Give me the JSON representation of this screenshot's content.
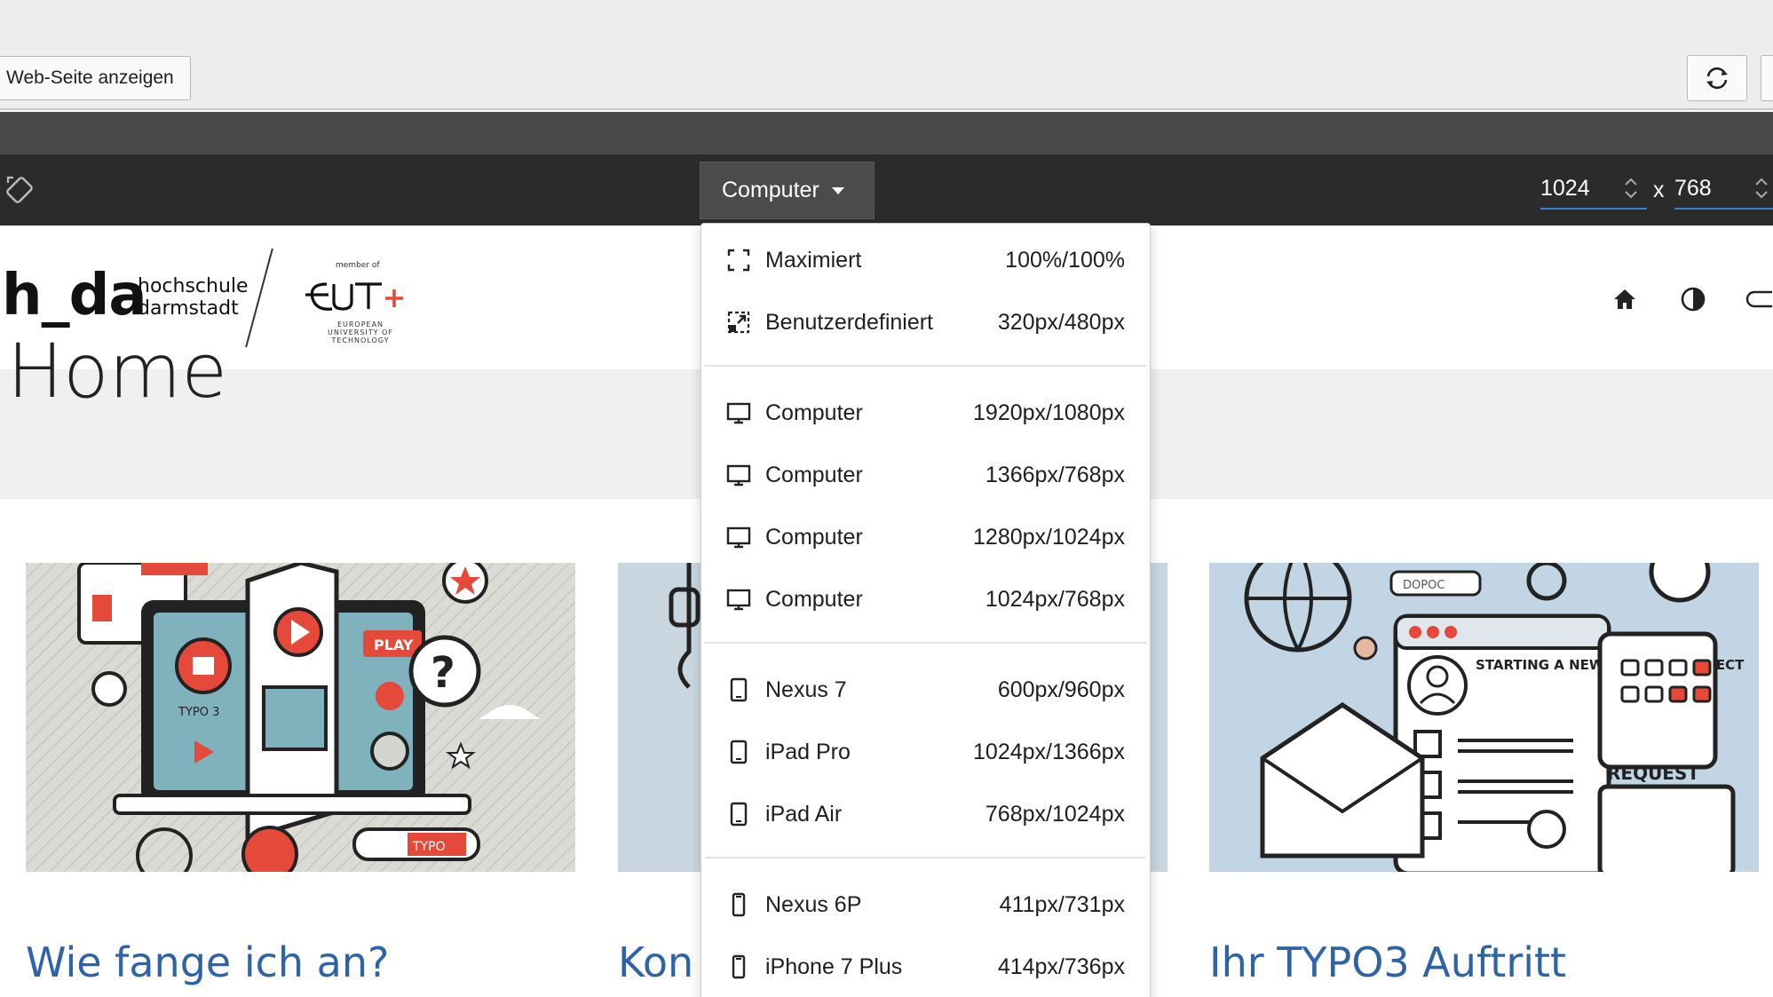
{
  "toolbar": {
    "view_webpage_label": "Web-Seite anzeigen"
  },
  "preview_bar": {
    "device_select_label": "Computer",
    "width_value": "1024",
    "height_value": "768",
    "dimension_separator": "x"
  },
  "site": {
    "logo_text": "h_da",
    "logo_line1": "hochschule",
    "logo_line2": "darmstadt",
    "partner_member": "member of",
    "partner_sub": "EUROPEAN UNIVERSITY OF TECHNOLOGY",
    "page_title": "Home",
    "cards": [
      {
        "title": "Wie fange ich an?",
        "image_text_1": "PLAY",
        "image_text_2": "TYPO 3",
        "image_text_3": "TYPO"
      },
      {
        "title": "Kon"
      },
      {
        "title": "Ihr TYPO3 Auftritt",
        "image_text_1": "STARTING A NEW WEBSITE PROJECT",
        "image_text_2": "REQUEST",
        "image_text_3": "DOPOC"
      }
    ]
  },
  "dropdown": {
    "items": [
      {
        "label": "Maximiert",
        "size": "100%/100%",
        "icon": "maximize-icon"
      },
      {
        "label": "Benutzerdefiniert",
        "size": "320px/480px",
        "icon": "custom-size-icon"
      },
      {
        "label": "Computer",
        "size": "1920px/1080px",
        "icon": "desktop-icon"
      },
      {
        "label": "Computer",
        "size": "1366px/768px",
        "icon": "desktop-icon"
      },
      {
        "label": "Computer",
        "size": "1280px/1024px",
        "icon": "desktop-icon"
      },
      {
        "label": "Computer",
        "size": "1024px/768px",
        "icon": "desktop-icon"
      },
      {
        "label": "Nexus 7",
        "size": "600px/960px",
        "icon": "tablet-icon"
      },
      {
        "label": "iPad Pro",
        "size": "1024px/1366px",
        "icon": "tablet-icon"
      },
      {
        "label": "iPad Air",
        "size": "768px/1024px",
        "icon": "tablet-icon"
      },
      {
        "label": "Nexus 6P",
        "size": "411px/731px",
        "icon": "phone-icon"
      },
      {
        "label": "iPhone 7 Plus",
        "size": "414px/736px",
        "icon": "phone-icon"
      }
    ]
  },
  "colors": {
    "accent_blue": "#2e63a8",
    "focus_blue": "#3b7fd1",
    "highlight_red": "#e5493a"
  }
}
